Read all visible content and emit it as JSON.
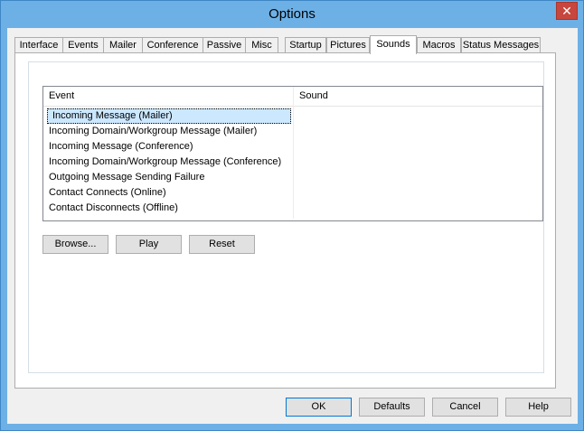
{
  "window": {
    "title": "Options",
    "close_glyph": "✕"
  },
  "tabs": [
    {
      "label": "Interface"
    },
    {
      "label": "Events"
    },
    {
      "label": "Mailer"
    },
    {
      "label": "Conference"
    },
    {
      "label": "Passive"
    },
    {
      "label": "Misc"
    },
    {
      "label": "Startup"
    },
    {
      "label": "Pictures"
    },
    {
      "label": "Sounds"
    },
    {
      "label": "Macros"
    },
    {
      "label": "Status Messages"
    }
  ],
  "active_tab": "Sounds",
  "sounds_list": {
    "columns": {
      "event": "Event",
      "sound": "Sound"
    },
    "rows": [
      {
        "event": "Incoming Message (Mailer)",
        "sound": ""
      },
      {
        "event": "Incoming Domain/Workgroup Message (Mailer)",
        "sound": ""
      },
      {
        "event": "Incoming Message (Conference)",
        "sound": ""
      },
      {
        "event": "Incoming Domain/Workgroup Message (Conference)",
        "sound": ""
      },
      {
        "event": "Outgoing Message Sending Failure",
        "sound": ""
      },
      {
        "event": "Contact Connects (Online)",
        "sound": ""
      },
      {
        "event": "Contact Disconnects (Offline)",
        "sound": ""
      }
    ],
    "selected_row": "Incoming Message (Mailer)"
  },
  "sound_buttons": {
    "browse": "Browse...",
    "play": "Play",
    "reset": "Reset"
  },
  "dialog_buttons": {
    "ok": "OK",
    "defaults": "Defaults",
    "cancel": "Cancel",
    "help": "Help"
  },
  "colors": {
    "title_bar": "#6db0e6",
    "close_button": "#c7463d",
    "selection": "#cce8ff",
    "default_button_border": "#0078d7"
  }
}
